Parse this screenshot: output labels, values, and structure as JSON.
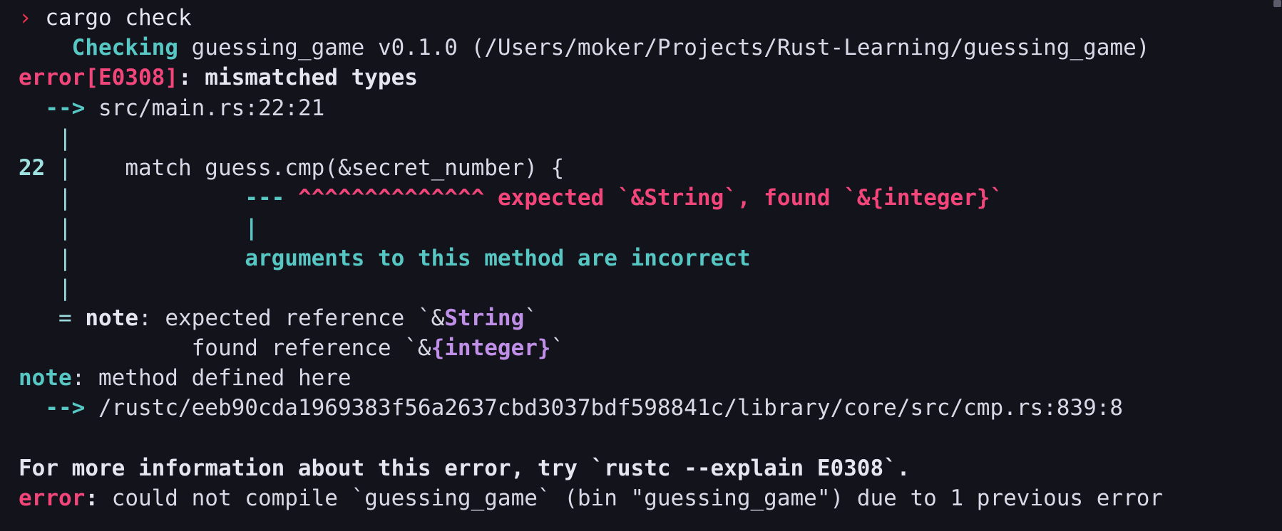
{
  "terminal": {
    "title": "cargo check output",
    "colors": {
      "background": "#13131c",
      "foreground": "#e6e6f0",
      "error": "#f2467b",
      "prompt": "#e8344c",
      "info": "#57c7c4",
      "type": "#c08fe8",
      "line_number": "#9fe0e0"
    },
    "prompt_symbol": "›",
    "command": "cargo check"
  },
  "output": {
    "checking": {
      "status": "Checking",
      "package": "guessing_game",
      "version": "v0.1.0",
      "path": "(/Users/moker/Projects/Rust-Learning/guessing_game)"
    },
    "error_header": {
      "label": "error[E0308]",
      "separator": ": ",
      "message": "mismatched types"
    },
    "location": {
      "arrow": "-->",
      "file": "src/main.rs:22:21"
    },
    "gutter": {
      "bar": "|",
      "line_number": "22"
    },
    "code_line": "    match guess.cmp(&secret_number) {",
    "annotation": {
      "dashes": "---",
      "carets": "^^^^^^^^^^^^^^",
      "expected_text": "expected ",
      "expected_type": "`&String`",
      "comma": ", ",
      "found_text": "found ",
      "found_type": "`&{integer}`"
    },
    "pipe_marker": "|",
    "arguments_note": "arguments to this method are incorrect",
    "notes": {
      "equals": "=",
      "note_label": "note",
      "note_colon": ": ",
      "expected_reference_prefix": "expected reference `&",
      "expected_reference_type": "String",
      "expected_reference_suffix": "`",
      "found_reference_prefix": "found reference `&",
      "found_reference_type": "{integer}",
      "found_reference_suffix": "`"
    },
    "method_note": {
      "label": "note",
      "colon": ": ",
      "text": "method defined here",
      "arrow": "-->",
      "path": "/rustc/eeb90cda1969383f56a2637cbd3037bdf598841c/library/core/src/cmp.rs:839:8"
    },
    "footer": {
      "more_info": "For more information about this error, try `rustc --explain E0308`.",
      "error_label": "error",
      "error_colon": ": ",
      "error_message": "could not compile `guessing_game` (bin \"guessing_game\") due to 1 previous error"
    }
  }
}
